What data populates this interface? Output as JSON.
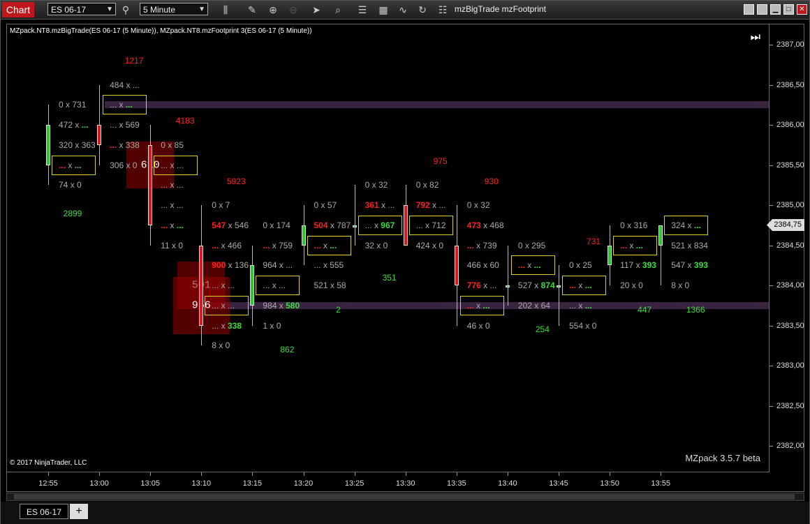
{
  "toolbar": {
    "chart_label": "Chart",
    "instrument": "ES 06-17",
    "interval": "5 Minute",
    "indicators": "mzBigTrade  mzFootprint"
  },
  "chart": {
    "title": "MZpack.NT8.mzBigTrade(ES 06-17 (5 Minute)), MZpack.NT8.mzFootprint 3(ES 06-17 (5 Minute))",
    "copyright": "© 2017 NinjaTrader, LLC",
    "version": "MZpack 3.5.7 beta",
    "fbutton": "F",
    "current_price": "2384,75",
    "y_ticks": [
      "2387,00",
      "2386,50",
      "2386,00",
      "2385,50",
      "2385,00",
      "2384,50",
      "2384,00",
      "2383,50",
      "2383,00",
      "2382,50",
      "2382,00"
    ],
    "x_ticks": [
      "12:55",
      "13:00",
      "13:05",
      "13:10",
      "13:15",
      "13:20",
      "13:25",
      "13:30",
      "13:35",
      "13:40",
      "13:45",
      "13:50",
      "13:55"
    ]
  },
  "chart_data": {
    "type": "candlestick-footprint",
    "candles": [
      {
        "time": "12:55",
        "open": 2385.5,
        "high": 2386.25,
        "low": 2385.25,
        "close": 2386.0
      },
      {
        "time": "13:00",
        "open": 2386.0,
        "high": 2386.5,
        "low": 2385.5,
        "close": 2385.75
      },
      {
        "time": "13:05",
        "open": 2385.75,
        "high": 2386.0,
        "low": 2384.5,
        "close": 2384.75
      },
      {
        "time": "13:10",
        "open": 2384.5,
        "high": 2385.0,
        "low": 2383.25,
        "close": 2383.5
      },
      {
        "time": "13:15",
        "open": 2383.75,
        "high": 2384.5,
        "low": 2383.5,
        "close": 2384.25
      },
      {
        "time": "13:20",
        "open": 2384.5,
        "high": 2385.0,
        "low": 2384.25,
        "close": 2384.75
      },
      {
        "time": "13:25",
        "open": 2384.75,
        "high": 2385.25,
        "low": 2384.5,
        "close": 2384.75
      },
      {
        "time": "13:30",
        "open": 2385.0,
        "high": 2385.25,
        "low": 2384.5,
        "close": 2384.5
      },
      {
        "time": "13:35",
        "open": 2384.5,
        "high": 2385.0,
        "low": 2383.5,
        "close": 2384.0
      },
      {
        "time": "13:40",
        "open": 2384.0,
        "high": 2384.5,
        "low": 2383.75,
        "close": 2384.0
      },
      {
        "time": "13:45",
        "open": 2384.0,
        "high": 2384.25,
        "low": 2383.5,
        "close": 2384.0
      },
      {
        "time": "13:50",
        "open": 2384.25,
        "high": 2384.75,
        "low": 2384.0,
        "close": 2384.5
      },
      {
        "time": "13:55",
        "open": 2384.5,
        "high": 2384.75,
        "low": 2384.0,
        "close": 2384.75
      }
    ],
    "levels": [
      2386.25,
      2383.75
    ],
    "footprint": [
      {
        "x": 0,
        "p": 2386.25,
        "bid": "0",
        "ask": "731"
      },
      {
        "x": 0,
        "p": 2386.0,
        "bid": "472",
        "ask": "...",
        "askc": "g"
      },
      {
        "x": 0,
        "p": 2385.75,
        "bid": "320",
        "ask": "363"
      },
      {
        "x": 0,
        "p": 2385.5,
        "bid": "...",
        "ask": "...",
        "bidc": "r",
        "askc": "g",
        "box": true
      },
      {
        "x": 0,
        "p": 2385.25,
        "bid": "74",
        "ask": "0"
      },
      {
        "x": 1,
        "p": 2386.5,
        "bid": "484",
        "ask": "..."
      },
      {
        "x": 1,
        "p": 2386.25,
        "bid": "...",
        "ask": "...",
        "askc": "g",
        "box": true
      },
      {
        "x": 1,
        "p": 2386.0,
        "bid": "...",
        "ask": "569"
      },
      {
        "x": 1,
        "p": 2385.75,
        "bid": "...",
        "ask": "338",
        "bidc": "r"
      },
      {
        "x": 1,
        "p": 2385.5,
        "bid": "306",
        "ask": "0"
      },
      {
        "x": 2,
        "p": 2385.75,
        "bid": "0",
        "ask": "85"
      },
      {
        "x": 2,
        "p": 2385.5,
        "bid": "...",
        "ask": "...",
        "box": true
      },
      {
        "x": 2,
        "p": 2385.25,
        "bid": "...",
        "ask": "..."
      },
      {
        "x": 2,
        "p": 2385.0,
        "bid": "...",
        "ask": "..."
      },
      {
        "x": 2,
        "p": 2384.75,
        "bid": "...",
        "ask": "...",
        "bidc": "r",
        "askc": "g"
      },
      {
        "x": 2,
        "p": 2384.5,
        "bid": "11",
        "ask": "0"
      },
      {
        "x": 3,
        "p": 2385.0,
        "bid": "0",
        "ask": "7"
      },
      {
        "x": 3,
        "p": 2384.75,
        "bid": "547",
        "ask": "546",
        "bidc": "r"
      },
      {
        "x": 3,
        "p": 2384.5,
        "bid": "...",
        "ask": "466",
        "bidc": "r"
      },
      {
        "x": 3,
        "p": 2384.25,
        "bid": "900",
        "ask": "136",
        "bidc": "r"
      },
      {
        "x": 3,
        "p": 2384.0,
        "bid": "...",
        "ask": "..."
      },
      {
        "x": 3,
        "p": 2383.75,
        "bid": "...",
        "ask": "...",
        "box": true
      },
      {
        "x": 3,
        "p": 2383.5,
        "bid": "...",
        "ask": "338",
        "askc": "g"
      },
      {
        "x": 3,
        "p": 2383.25,
        "bid": "8",
        "ask": "0"
      },
      {
        "x": 4,
        "p": 2384.75,
        "bid": "0",
        "ask": "174"
      },
      {
        "x": 4,
        "p": 2384.5,
        "bid": "...",
        "ask": "759",
        "bidc": "r"
      },
      {
        "x": 4,
        "p": 2384.25,
        "bid": "964",
        "ask": "..."
      },
      {
        "x": 4,
        "p": 2384.0,
        "bid": "...",
        "ask": "...",
        "box": true
      },
      {
        "x": 4,
        "p": 2383.75,
        "bid": "984",
        "ask": "580",
        "askc": "g"
      },
      {
        "x": 4,
        "p": 2383.5,
        "bid": "1",
        "ask": "0"
      },
      {
        "x": 5,
        "p": 2385.0,
        "bid": "0",
        "ask": "57"
      },
      {
        "x": 5,
        "p": 2384.75,
        "bid": "504",
        "ask": "787",
        "bidc": "r"
      },
      {
        "x": 5,
        "p": 2384.5,
        "bid": "...",
        "ask": "...",
        "bidc": "r",
        "askc": "g",
        "box": true
      },
      {
        "x": 5,
        "p": 2384.25,
        "bid": "...",
        "ask": "555"
      },
      {
        "x": 5,
        "p": 2384.0,
        "bid": "521",
        "ask": "58"
      },
      {
        "x": 6,
        "p": 2385.25,
        "bid": "0",
        "ask": "32"
      },
      {
        "x": 6,
        "p": 2385.0,
        "bid": "361",
        "ask": "...",
        "bidc": "r"
      },
      {
        "x": 6,
        "p": 2384.75,
        "bid": "...",
        "ask": "967",
        "askc": "g",
        "box": true
      },
      {
        "x": 6,
        "p": 2384.5,
        "bid": "32",
        "ask": "0"
      },
      {
        "x": 7,
        "p": 2385.25,
        "bid": "0",
        "ask": "82"
      },
      {
        "x": 7,
        "p": 2385.0,
        "bid": "792",
        "ask": "...",
        "bidc": "r"
      },
      {
        "x": 7,
        "p": 2384.75,
        "bid": "...",
        "ask": "712",
        "box": true
      },
      {
        "x": 7,
        "p": 2384.5,
        "bid": "424",
        "ask": "0"
      },
      {
        "x": 8,
        "p": 2385.0,
        "bid": "0",
        "ask": "32"
      },
      {
        "x": 8,
        "p": 2384.75,
        "bid": "473",
        "ask": "468",
        "bidc": "r"
      },
      {
        "x": 8,
        "p": 2384.5,
        "bid": "...",
        "ask": "739",
        "bidc": "r"
      },
      {
        "x": 8,
        "p": 2384.25,
        "bid": "466",
        "ask": "60"
      },
      {
        "x": 8,
        "p": 2384.0,
        "bid": "776",
        "ask": "...",
        "bidc": "r"
      },
      {
        "x": 8,
        "p": 2383.75,
        "bid": "...",
        "ask": "...",
        "bidc": "r",
        "askc": "g",
        "box": true
      },
      {
        "x": 8,
        "p": 2383.5,
        "bid": "46",
        "ask": "0"
      },
      {
        "x": 9,
        "p": 2384.5,
        "bid": "0",
        "ask": "295"
      },
      {
        "x": 9,
        "p": 2384.25,
        "bid": "...",
        "ask": "...",
        "bidc": "r",
        "askc": "g",
        "box": true
      },
      {
        "x": 9,
        "p": 2384.0,
        "bid": "527",
        "ask": "874",
        "askc": "g"
      },
      {
        "x": 9,
        "p": 2383.75,
        "bid": "202",
        "ask": "64"
      },
      {
        "x": 10,
        "p": 2384.25,
        "bid": "0",
        "ask": "25"
      },
      {
        "x": 10,
        "p": 2384.0,
        "bid": "...",
        "ask": "...",
        "bidc": "r",
        "askc": "g",
        "box": true
      },
      {
        "x": 10,
        "p": 2383.75,
        "bid": "...",
        "ask": "...",
        "askc": "g"
      },
      {
        "x": 10,
        "p": 2383.5,
        "bid": "554",
        "ask": "0"
      },
      {
        "x": 11,
        "p": 2384.75,
        "bid": "0",
        "ask": "316"
      },
      {
        "x": 11,
        "p": 2384.5,
        "bid": "...",
        "ask": "...",
        "bidc": "r",
        "askc": "g",
        "box": true
      },
      {
        "x": 11,
        "p": 2384.25,
        "bid": "117",
        "ask": "393",
        "askc": "g"
      },
      {
        "x": 11,
        "p": 2384.0,
        "bid": "20",
        "ask": "0"
      },
      {
        "x": 12,
        "p": 2384.75,
        "bid": "324",
        "ask": "...",
        "askc": "g",
        "box": true
      },
      {
        "x": 12,
        "p": 2384.5,
        "bid": "521",
        "ask": "834"
      },
      {
        "x": 12,
        "p": 2384.25,
        "bid": "547",
        "ask": "393",
        "askc": "g"
      },
      {
        "x": 12,
        "p": 2384.0,
        "bid": "8",
        "ask": "0"
      }
    ],
    "deltas": [
      {
        "x": 0,
        "p": 2384.9,
        "v": "2899",
        "c": "g"
      },
      {
        "x": 1,
        "p": 2386.8,
        "v": "1217",
        "c": "r"
      },
      {
        "x": 2,
        "p": 2386.05,
        "v": "4183",
        "c": "r"
      },
      {
        "x": 3,
        "p": 2385.3,
        "v": "5923",
        "c": "r"
      },
      {
        "x": 4,
        "p": 2383.2,
        "v": "862",
        "c": "g"
      },
      {
        "x": 5,
        "p": 2383.7,
        "v": "2",
        "c": "g"
      },
      {
        "x": 6,
        "p": 2384.1,
        "v": "351",
        "c": "g"
      },
      {
        "x": 7,
        "p": 2385.55,
        "v": "975",
        "c": "r"
      },
      {
        "x": 8,
        "p": 2385.3,
        "v": "930",
        "c": "r"
      },
      {
        "x": 9,
        "p": 2383.45,
        "v": "254",
        "c": "g"
      },
      {
        "x": 10,
        "p": 2384.55,
        "v": "731",
        "c": "r"
      },
      {
        "x": 11,
        "p": 2383.7,
        "v": "447",
        "c": "g"
      },
      {
        "x": 12,
        "p": 2383.7,
        "v": "1366",
        "c": "g"
      }
    ],
    "big_trades": [
      {
        "x": 2,
        "p": 2385.5,
        "v": "610",
        "size": 2
      },
      {
        "x": 3,
        "p": 2384.0,
        "v": "501",
        "size": 2
      },
      {
        "x": 3,
        "p": 2383.75,
        "v": "956",
        "size": 2.4
      }
    ]
  },
  "colors": {
    "up": "#2ec82e",
    "down": "#e0161c",
    "level": "#3a2340",
    "box": "#d9cf2f",
    "red": "#ff2020",
    "green": "#3ddc3d"
  },
  "tabs": {
    "instrument_tab": "ES 06-17",
    "add_tab": "+"
  }
}
